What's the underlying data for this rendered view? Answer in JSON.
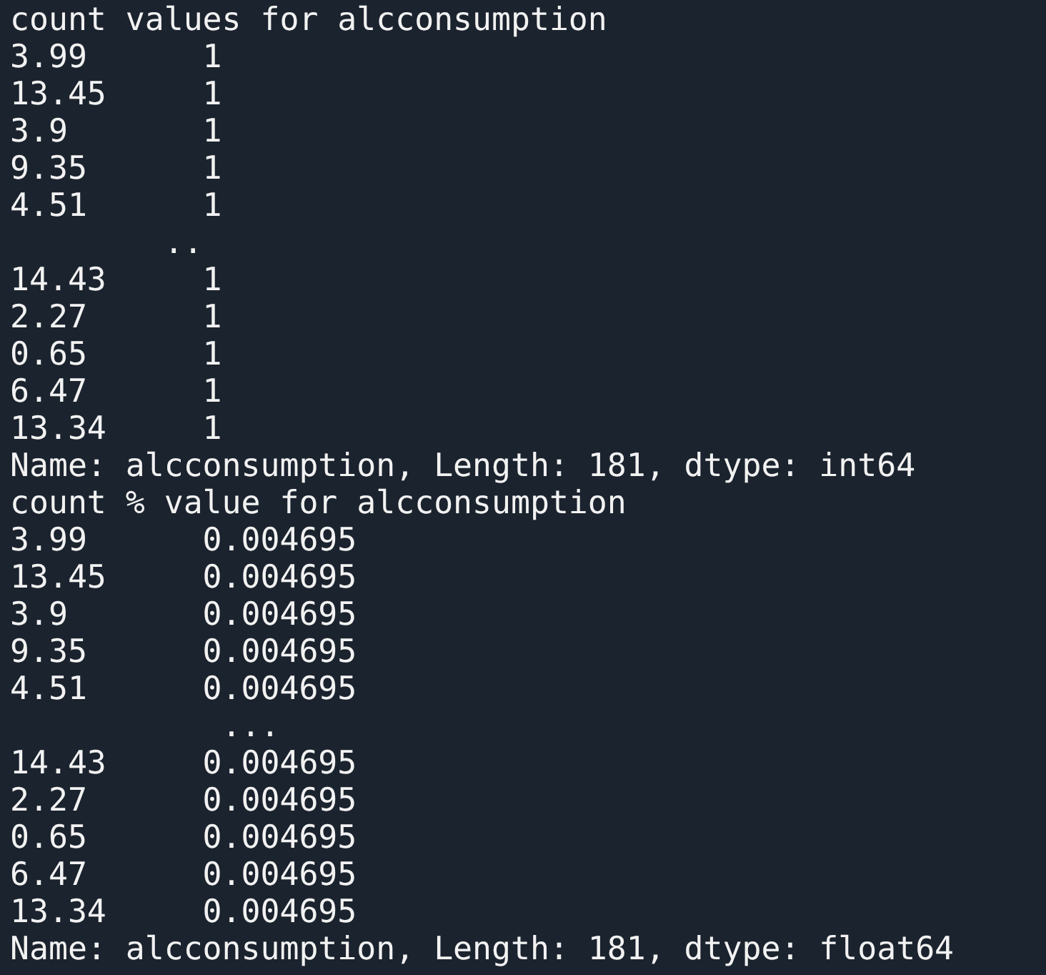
{
  "terminal": {
    "lines": [
      "count values for alcconsumption",
      "3.99      1",
      "13.45     1",
      "3.9       1",
      "9.35      1",
      "4.51      1",
      "        ..",
      "14.43     1",
      "2.27      1",
      "0.65      1",
      "6.47      1",
      "13.34     1",
      "Name: alcconsumption, Length: 181, dtype: int64",
      "count % value for alcconsumption",
      "3.99      0.004695",
      "13.45     0.004695",
      "3.9       0.004695",
      "9.35      0.004695",
      "4.51      0.004695",
      "           ...",
      "14.43     0.004695",
      "2.27      0.004695",
      "0.65      0.004695",
      "6.47      0.004695",
      "13.34     0.004695",
      "Name: alcconsumption, Length: 181, dtype: float64"
    ]
  }
}
